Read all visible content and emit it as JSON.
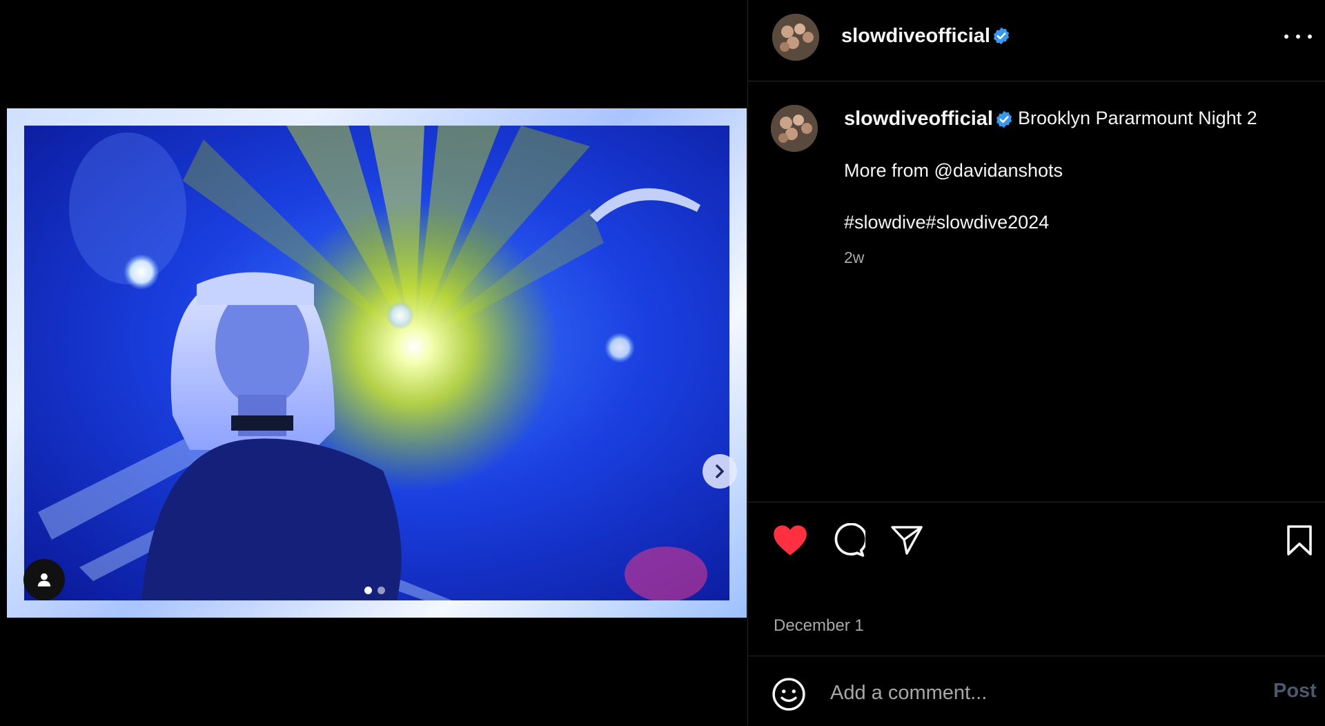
{
  "post": {
    "username": "slowdiveofficial",
    "verified": true,
    "verified_icon": "verified-badge-icon",
    "more_icon": "more-options-icon"
  },
  "media": {
    "slide_count": 2,
    "active_slide": 1,
    "next_icon": "chevron-right-icon",
    "tag_icon": "user-tag-icon"
  },
  "caption": {
    "username": "slowdiveofficial",
    "title": "Brooklyn Pararmount Night 2",
    "line2": "More from @davidanshots",
    "hashtags": "#slowdive#slowdive2024",
    "age": "2w"
  },
  "actions": {
    "liked": true,
    "like_icon": "heart-filled-icon",
    "comment_icon": "comment-bubble-icon",
    "share_icon": "send-paper-plane-icon",
    "save_icon": "bookmark-icon",
    "date": "December 1"
  },
  "comment": {
    "emoji_icon": "emoji-smile-icon",
    "placeholder": "Add a comment...",
    "post_label": "Post"
  },
  "colors": {
    "background": "#000000",
    "like_red": "#ff3040",
    "verified_blue": "#3897f0",
    "muted_text": "#a8a8a8",
    "divider": "#262626"
  }
}
